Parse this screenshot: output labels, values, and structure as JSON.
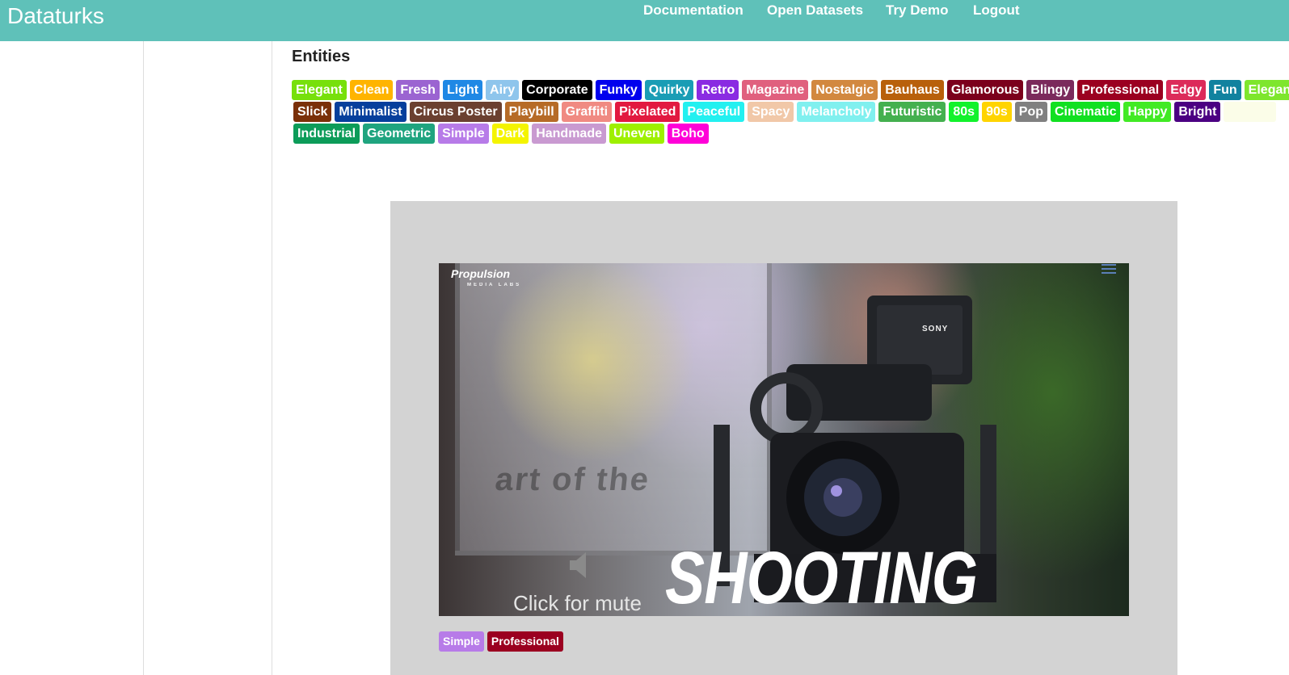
{
  "app": {
    "brand": "Dataturks"
  },
  "nav": [
    {
      "label": "Documentation"
    },
    {
      "label": "Open Datasets"
    },
    {
      "label": "Try Demo"
    },
    {
      "label": "Logout"
    }
  ],
  "entities": {
    "title": "Entities",
    "rows": [
      [
        {
          "label": "Elegant",
          "color": "#77e00b"
        },
        {
          "label": "Clean",
          "color": "#ffb400"
        },
        {
          "label": "Fresh",
          "color": "#9b64d1"
        },
        {
          "label": "Light",
          "color": "#1f88e5"
        },
        {
          "label": "Airy",
          "color": "#8ec5ec"
        },
        {
          "label": "Corporate",
          "color": "#000000"
        },
        {
          "label": "Funky",
          "color": "#0000ee"
        },
        {
          "label": "Quirky",
          "color": "#1a9db5"
        },
        {
          "label": "Retro",
          "color": "#8a2be2"
        },
        {
          "label": "Magazine",
          "color": "#e0607e"
        },
        {
          "label": "Nostalgic",
          "color": "#d2883f"
        },
        {
          "label": "Bauhaus",
          "color": "#b8600b"
        },
        {
          "label": "Glamorous",
          "color": "#7b001c"
        },
        {
          "label": "Blingy",
          "color": "#7b2a5c"
        },
        {
          "label": "Professional",
          "color": "#9b0020"
        },
        {
          "label": "Edgy",
          "color": "#dc2b5a"
        },
        {
          "label": "Fun",
          "color": "#11829f"
        },
        {
          "label": "Elegant",
          "color": "#7ee62d"
        }
      ],
      [
        {
          "label": "Slick",
          "color": "#7a3008"
        },
        {
          "label": "Minimalist",
          "color": "#063f9c"
        },
        {
          "label": "Circus Poster",
          "color": "#6b4030"
        },
        {
          "label": "Playbill",
          "color": "#b66b27"
        },
        {
          "label": "Graffiti",
          "color": "#f08a82"
        },
        {
          "label": "Pixelated",
          "color": "#e21940"
        },
        {
          "label": "Peaceful",
          "color": "#22f0f0"
        },
        {
          "label": "Spacy",
          "color": "#f1c8a8"
        },
        {
          "label": "Melancholy",
          "color": "#80f0ef"
        },
        {
          "label": "Futuristic",
          "color": "#44b04f"
        },
        {
          "label": "80s",
          "color": "#12f22c"
        },
        {
          "label": "90s",
          "color": "#ffd400"
        },
        {
          "label": "Pop",
          "color": "#808080"
        },
        {
          "label": "Cinematic",
          "color": "#11e021"
        },
        {
          "label": "Happy",
          "color": "#41ea24"
        },
        {
          "label": "Bright",
          "color": "#4b0082"
        },
        {
          "label": "",
          "color": "#fbfde8"
        }
      ],
      [
        {
          "label": "Industrial",
          "color": "#0c9c59"
        },
        {
          "label": "Geometric",
          "color": "#1fa47f"
        },
        {
          "label": "Simple",
          "color": "#b77be8"
        },
        {
          "label": "Dark",
          "color": "#f4f400"
        },
        {
          "label": "Handmade",
          "color": "#c99ad1"
        },
        {
          "label": "Uneven",
          "color": "#9ef000"
        },
        {
          "label": "Boho",
          "color": "#ff00d8"
        }
      ]
    ]
  },
  "video": {
    "logo": "Propulsion",
    "logo_sub": "MEDIA LABS",
    "brand_mark": "SONY",
    "poster_text": "art of the",
    "mute_label": "Click for mute",
    "caption": "SHOOTING",
    "tags": [
      {
        "label": "Simple",
        "color": "#b77be8"
      },
      {
        "label": "Professional",
        "color": "#9b0020"
      }
    ]
  }
}
